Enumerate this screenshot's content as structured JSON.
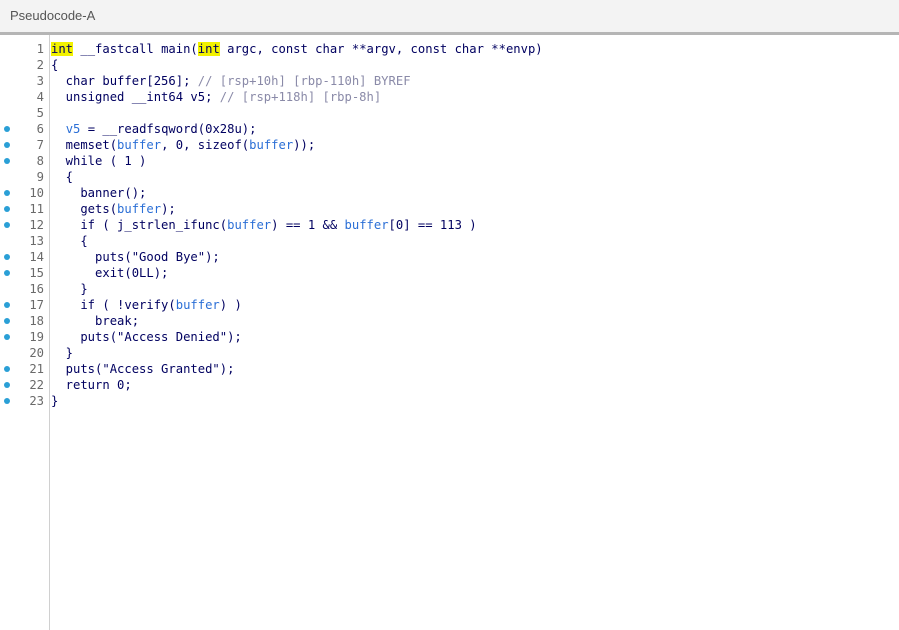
{
  "tab": {
    "title": "Pseudocode-A"
  },
  "colors": {
    "breakpoint": "#2a9fd6",
    "highlight": "#f2f200",
    "text": "#000060",
    "comment": "#8a8aa8",
    "variable": "#2b6fd6"
  },
  "lines": [
    {
      "num": "1",
      "bp": false,
      "tokens": [
        {
          "t": "int",
          "c": "kw"
        },
        {
          "t": " __fastcall main(",
          "c": ""
        },
        {
          "t": "int",
          "c": "kw"
        },
        {
          "t": " argc, const char **argv, const char **envp)",
          "c": ""
        }
      ]
    },
    {
      "num": "2",
      "bp": false,
      "tokens": [
        {
          "t": "{",
          "c": ""
        }
      ]
    },
    {
      "num": "3",
      "bp": false,
      "tokens": [
        {
          "t": "  char buffer[256]; ",
          "c": ""
        },
        {
          "t": "// [rsp+10h] [rbp-110h] BYREF",
          "c": "cmt"
        }
      ]
    },
    {
      "num": "4",
      "bp": false,
      "tokens": [
        {
          "t": "  unsigned __int64 v5; ",
          "c": ""
        },
        {
          "t": "// [rsp+118h] [rbp-8h]",
          "c": "cmt"
        }
      ]
    },
    {
      "num": "5",
      "bp": false,
      "tokens": []
    },
    {
      "num": "6",
      "bp": true,
      "tokens": [
        {
          "t": "  ",
          "c": ""
        },
        {
          "t": "v5",
          "c": "var"
        },
        {
          "t": " = __readfsqword(0x28u);",
          "c": ""
        }
      ]
    },
    {
      "num": "7",
      "bp": true,
      "tokens": [
        {
          "t": "  memset(",
          "c": ""
        },
        {
          "t": "buffer",
          "c": "var"
        },
        {
          "t": ", 0, sizeof(",
          "c": ""
        },
        {
          "t": "buffer",
          "c": "var"
        },
        {
          "t": "));",
          "c": ""
        }
      ]
    },
    {
      "num": "8",
      "bp": true,
      "tokens": [
        {
          "t": "  while ( 1 )",
          "c": ""
        }
      ]
    },
    {
      "num": "9",
      "bp": false,
      "tokens": [
        {
          "t": "  {",
          "c": ""
        }
      ]
    },
    {
      "num": "10",
      "bp": true,
      "tokens": [
        {
          "t": "    banner();",
          "c": ""
        }
      ]
    },
    {
      "num": "11",
      "bp": true,
      "tokens": [
        {
          "t": "    gets(",
          "c": ""
        },
        {
          "t": "buffer",
          "c": "var"
        },
        {
          "t": ");",
          "c": ""
        }
      ]
    },
    {
      "num": "12",
      "bp": true,
      "tokens": [
        {
          "t": "    if ( j_strlen_ifunc(",
          "c": ""
        },
        {
          "t": "buffer",
          "c": "var"
        },
        {
          "t": ") == 1 && ",
          "c": ""
        },
        {
          "t": "buffer",
          "c": "var"
        },
        {
          "t": "[0] == 113 )",
          "c": ""
        }
      ]
    },
    {
      "num": "13",
      "bp": false,
      "tokens": [
        {
          "t": "    {",
          "c": ""
        }
      ]
    },
    {
      "num": "14",
      "bp": true,
      "tokens": [
        {
          "t": "      puts(\"Good Bye\");",
          "c": ""
        }
      ]
    },
    {
      "num": "15",
      "bp": true,
      "tokens": [
        {
          "t": "      exit(0LL);",
          "c": ""
        }
      ]
    },
    {
      "num": "16",
      "bp": false,
      "tokens": [
        {
          "t": "    }",
          "c": ""
        }
      ]
    },
    {
      "num": "17",
      "bp": true,
      "tokens": [
        {
          "t": "    if ( !verify(",
          "c": ""
        },
        {
          "t": "buffer",
          "c": "var"
        },
        {
          "t": ") )",
          "c": ""
        }
      ]
    },
    {
      "num": "18",
      "bp": true,
      "tokens": [
        {
          "t": "      break;",
          "c": ""
        }
      ]
    },
    {
      "num": "19",
      "bp": true,
      "tokens": [
        {
          "t": "    puts(\"Access Denied\");",
          "c": ""
        }
      ]
    },
    {
      "num": "20",
      "bp": false,
      "tokens": [
        {
          "t": "  }",
          "c": ""
        }
      ]
    },
    {
      "num": "21",
      "bp": true,
      "tokens": [
        {
          "t": "  puts(\"Access Granted\");",
          "c": ""
        }
      ]
    },
    {
      "num": "22",
      "bp": true,
      "tokens": [
        {
          "t": "  return 0;",
          "c": ""
        }
      ]
    },
    {
      "num": "23",
      "bp": true,
      "tokens": [
        {
          "t": "}",
          "c": ""
        }
      ]
    }
  ]
}
